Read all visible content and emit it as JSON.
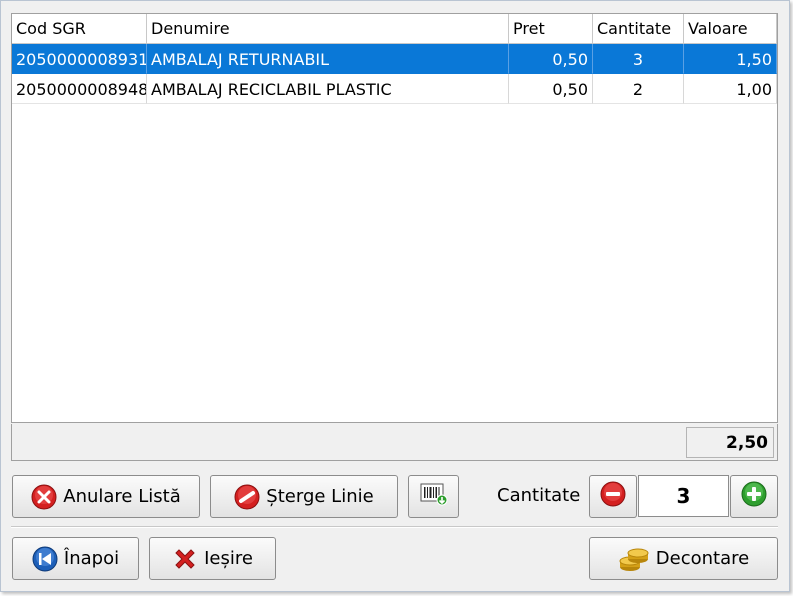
{
  "grid": {
    "columns": [
      "Cod SGR",
      "Denumire",
      "Pret",
      "Cantitate",
      "Valoare"
    ],
    "rows": [
      {
        "cod": "2050000008931",
        "denumire": "AMBALAJ RETURNABIL",
        "pret": "0,50",
        "cantitate": "3",
        "valoare": "1,50",
        "selected": true
      },
      {
        "cod": "2050000008948",
        "denumire": "AMBALAJ RECICLABIL PLASTIC",
        "pret": "0,50",
        "cantitate": "2",
        "valoare": "1,00",
        "selected": false
      }
    ],
    "total": "2,50"
  },
  "actions": {
    "anulare_label": "Anulare Listă",
    "sterge_label": "Șterge Linie",
    "barcode_icon": "barcode-icon"
  },
  "quantity": {
    "label": "Cantitate",
    "value": "3"
  },
  "footer": {
    "inapoi_label": "Înapoi",
    "iesire_label": "Ieșire",
    "decontare_label": "Decontare"
  },
  "colors": {
    "selection": "#0a78d7",
    "window_bg": "#f0f0f0",
    "cancel_red": "#d42020",
    "add_green": "#2e9e2e",
    "back_blue": "#1d5fb8"
  }
}
